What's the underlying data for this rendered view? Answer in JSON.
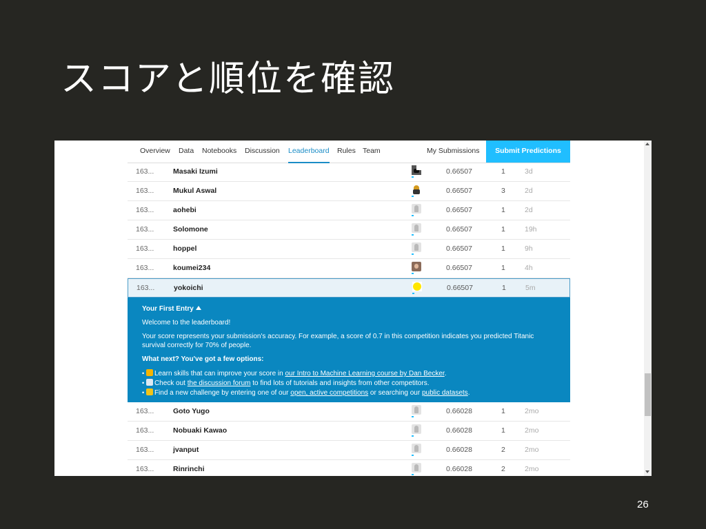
{
  "slide": {
    "title": "スコアと順位を確認",
    "page_number": "26"
  },
  "nav": {
    "tabs": [
      "Overview",
      "Data",
      "Notebooks",
      "Discussion",
      "Leaderboard",
      "Rules",
      "Team"
    ],
    "active_tab": "Leaderboard",
    "my_submissions": "My Submissions",
    "submit_button": "Submit Predictions"
  },
  "rows_top": [
    {
      "rank": "163...",
      "name": "Masaki Izumi",
      "avatar": "cat-avatar-icon",
      "score": "0.66507",
      "entries": "1",
      "last": "3d"
    },
    {
      "rank": "163...",
      "name": "Mukul Aswal",
      "avatar": "character-avatar-icon",
      "score": "0.66507",
      "entries": "3",
      "last": "2d"
    },
    {
      "rank": "163...",
      "name": "aohebi",
      "avatar": "default-avatar-icon",
      "score": "0.66507",
      "entries": "1",
      "last": "2d"
    },
    {
      "rank": "163...",
      "name": "Solomone",
      "avatar": "default-avatar-icon",
      "score": "0.66507",
      "entries": "1",
      "last": "19h"
    },
    {
      "rank": "163...",
      "name": "hoppel",
      "avatar": "default-avatar-icon",
      "score": "0.66507",
      "entries": "1",
      "last": "9h"
    },
    {
      "rank": "163...",
      "name": "koumei234",
      "avatar": "photo-avatar-icon",
      "score": "0.66507",
      "entries": "1",
      "last": "4h"
    },
    {
      "rank": "163...",
      "name": "yokoichi",
      "avatar": "smiley-avatar-icon",
      "score": "0.66507",
      "entries": "1",
      "last": "5m"
    }
  ],
  "banner": {
    "title": "Your First Entry",
    "welcome": "Welcome to the leaderboard!",
    "desc_line1": "Your score represents your submission's accuracy. For example, a score of 0.7 in this competition indicates you predicted Titanic",
    "desc_line2": "survival correctly for 70% of people.",
    "next": "What next? You've got a few options:",
    "opt1_pre": "Learn skills that can improve your score in ",
    "opt1_link": "our Intro to Machine Learning course by Dan Becker",
    "opt1_post": ".",
    "opt2_pre": "Check out ",
    "opt2_link": "the discussion forum",
    "opt2_post": " to find lots of tutorials and insights from other competitors.",
    "opt3_pre": "Find a new challenge by entering one of our ",
    "opt3_link1": "open, active competitions",
    "opt3_mid": " or searching our ",
    "opt3_link2": "public datasets",
    "opt3_post": "."
  },
  "rows_bottom": [
    {
      "rank": "163...",
      "name": "Goto Yugo",
      "avatar": "default-avatar-icon",
      "score": "0.66028",
      "entries": "1",
      "last": "2mo"
    },
    {
      "rank": "163...",
      "name": "Nobuaki Kawao",
      "avatar": "default-avatar-icon",
      "score": "0.66028",
      "entries": "1",
      "last": "2mo"
    },
    {
      "rank": "163...",
      "name": "jvanput",
      "avatar": "default-avatar-icon",
      "score": "0.66028",
      "entries": "2",
      "last": "2mo"
    },
    {
      "rank": "163...",
      "name": "Rinrinchi",
      "avatar": "default-avatar-icon",
      "score": "0.66028",
      "entries": "2",
      "last": "2mo"
    }
  ],
  "colors": {
    "slide_bg": "#262622",
    "accent": "#20beff",
    "banner_bg": "#0a87c0",
    "active_tab": "#1a8cc6"
  }
}
